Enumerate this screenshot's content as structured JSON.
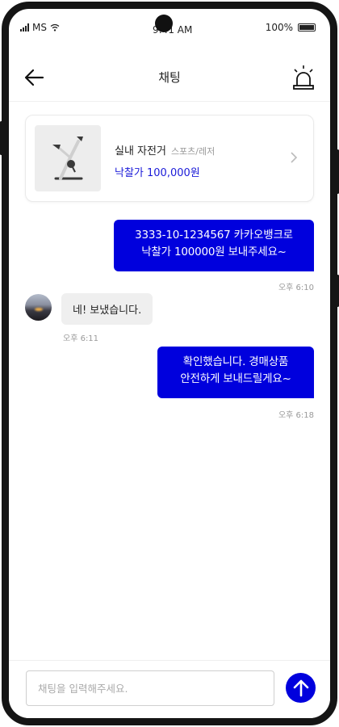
{
  "status_bar": {
    "carrier": "MS",
    "time": "9:41 AM",
    "battery": "100%"
  },
  "header": {
    "title": "채팅"
  },
  "product": {
    "name": "실내 자전거",
    "category": "스포츠/레저",
    "price": "낙찰가 100,000원"
  },
  "messages": [
    {
      "side": "sent",
      "lines": [
        "3333-10-1234567 카카오뱅크로",
        "낙찰가 100000원 보내주세요~"
      ],
      "time": "오후 6:10"
    },
    {
      "side": "received",
      "lines": [
        "네! 보냈습니다."
      ],
      "time": "오후 6:11"
    },
    {
      "side": "sent",
      "lines": [
        "확인했습니다. 경매상품",
        "안전하게 보내드릴게요~"
      ],
      "time": "오후 6:18"
    }
  ],
  "input": {
    "placeholder": "채팅을 입력해주세요.",
    "value": ""
  },
  "colors": {
    "accent": "#0000dd",
    "price": "#1a1ad8",
    "bubble_received": "#efefef",
    "timestamp": "#999999"
  },
  "icons": {
    "back": "arrow-left-icon",
    "alarm": "siren-icon",
    "chevron": "chevron-right-icon",
    "send": "arrow-up-icon"
  }
}
